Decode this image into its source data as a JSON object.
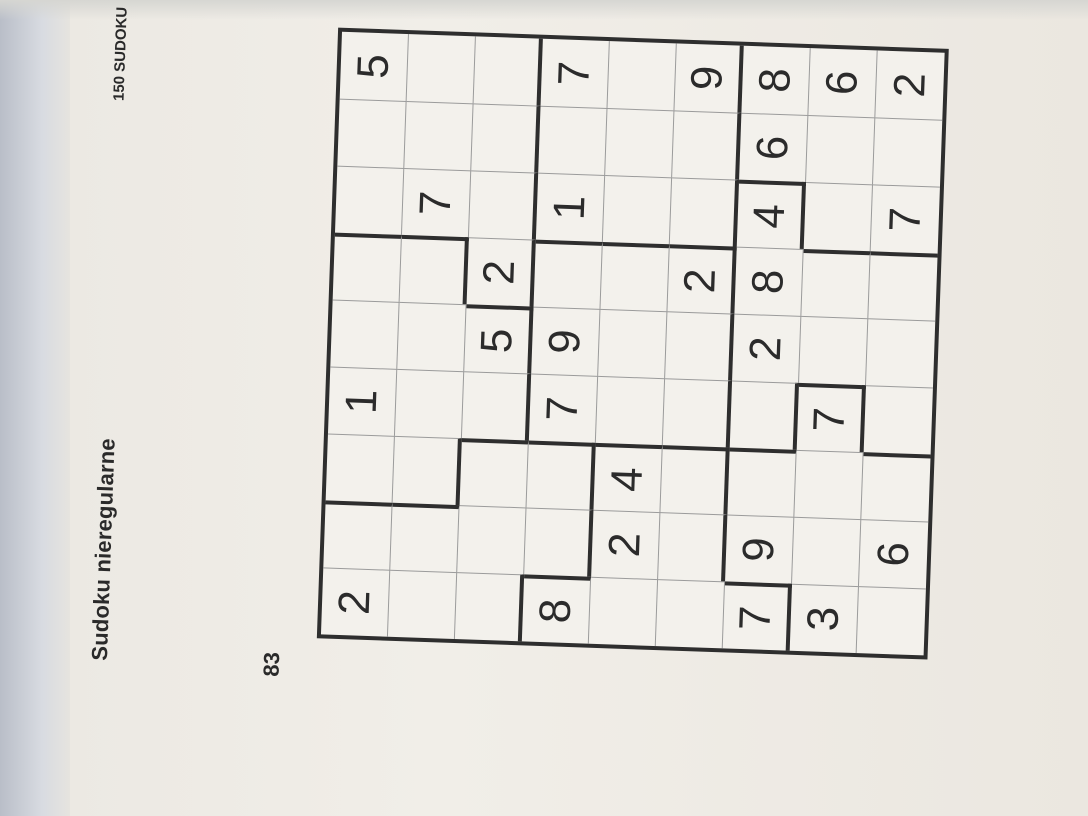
{
  "page": {
    "title": "Sudoku nieregularne",
    "series": "150 SUDOKU",
    "puzzle_number": "83"
  },
  "grid": [
    [
      "2",
      "",
      "",
      "1",
      "",
      "",
      "",
      "",
      "5"
    ],
    [
      "",
      "",
      "",
      "",
      "",
      "",
      "7",
      "",
      ""
    ],
    [
      "",
      "",
      "",
      "",
      "5",
      "2",
      "",
      "",
      ""
    ],
    [
      "8",
      "",
      "",
      "7",
      "9",
      "",
      "1",
      "",
      "7"
    ],
    [
      "",
      "2",
      "4",
      "",
      "",
      "",
      "",
      "",
      ""
    ],
    [
      "",
      "",
      "",
      "",
      "",
      "2",
      "",
      "",
      "9"
    ],
    [
      "7",
      "9",
      "",
      "",
      "2",
      "8",
      "4",
      "6",
      "8"
    ],
    [
      "3",
      "",
      "",
      "7",
      "",
      "",
      "",
      "",
      "6"
    ],
    [
      "",
      "6",
      "",
      "",
      "",
      "",
      "7",
      "",
      "2"
    ]
  ],
  "regions": [
    [
      0,
      0,
      1,
      1,
      1,
      1,
      2,
      2,
      2
    ],
    [
      0,
      0,
      1,
      1,
      1,
      1,
      2,
      2,
      2
    ],
    [
      0,
      0,
      0,
      1,
      1,
      2,
      2,
      2,
      2
    ],
    [
      3,
      0,
      0,
      4,
      4,
      4,
      5,
      5,
      5
    ],
    [
      3,
      3,
      3,
      4,
      4,
      4,
      5,
      5,
      5
    ],
    [
      3,
      3,
      3,
      4,
      4,
      4,
      5,
      5,
      5
    ],
    [
      3,
      6,
      6,
      7,
      7,
      7,
      7,
      8,
      8
    ],
    [
      6,
      6,
      6,
      6,
      7,
      7,
      8,
      8,
      8
    ],
    [
      6,
      6,
      6,
      7,
      7,
      7,
      8,
      8,
      8
    ]
  ]
}
